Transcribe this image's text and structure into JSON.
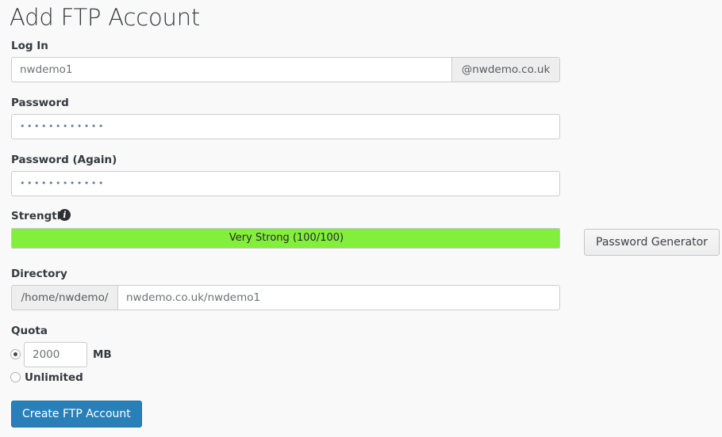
{
  "page": {
    "title": "Add FTP Account",
    "background_color": "#f9f9f9"
  },
  "form": {
    "login": {
      "label": "Log In",
      "value": "nwdemo1",
      "placeholder": "",
      "domain_addon": "@nwdemo.co.uk"
    },
    "password": {
      "label": "Password",
      "value": "••••••••••••",
      "placeholder": ""
    },
    "password_again": {
      "label": "Password (Again)",
      "value": "••••••••••••",
      "placeholder": ""
    },
    "strength": {
      "label": "Strength",
      "info_icon": "info-icon",
      "info_glyph": "i",
      "text": "Very Strong (100/100)",
      "score": 100,
      "max_score": 100,
      "percent": 100,
      "bar_color": "#82ef3a"
    },
    "password_generator": {
      "label": "Password Generator"
    },
    "directory": {
      "label": "Directory",
      "prefix": "/home/nwdemo/",
      "value": "nwdemo.co.uk/nwdemo1",
      "placeholder": ""
    },
    "quota": {
      "label": "Quota",
      "selected_option": "limited",
      "limited": {
        "value": "2000",
        "unit": "MB"
      },
      "unlimited": {
        "label": "Unlimited"
      }
    },
    "submit": {
      "label": "Create FTP Account",
      "color": "#2980b9"
    }
  }
}
